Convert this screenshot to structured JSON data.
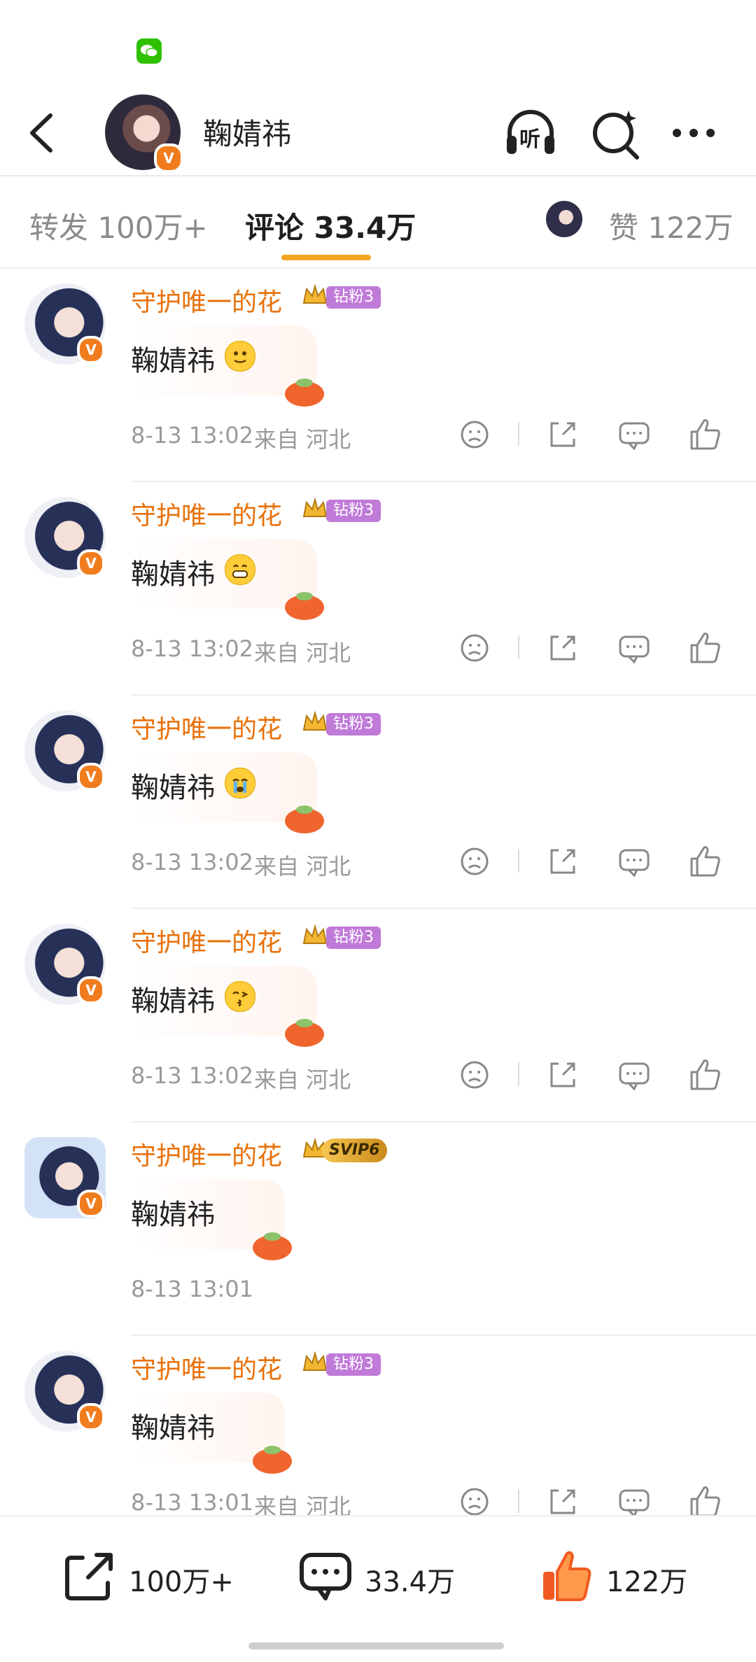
{
  "status_bar": {
    "app_icon": "wechat-icon"
  },
  "header": {
    "title": "鞠婧祎",
    "listen_label": "听",
    "icons": [
      "back-icon",
      "listen-icon",
      "search-ai-icon",
      "more-icon"
    ]
  },
  "tabs": {
    "repost": "转发 100万+",
    "comments": "评论 33.4万",
    "likes": "赞 122万"
  },
  "comments": [
    {
      "user": "守护唯一的花",
      "badge_type": "fan",
      "badge": "钻粉3",
      "text": "鞠婧祎",
      "emoji": "slight-smile",
      "time": "8-13 13:02",
      "location": "来自 河北"
    },
    {
      "user": "守护唯一的花",
      "badge_type": "fan",
      "badge": "钻粉3",
      "text": "鞠婧祎",
      "emoji": "grin",
      "time": "8-13 13:02",
      "location": "来自 河北"
    },
    {
      "user": "守护唯一的花",
      "badge_type": "fan",
      "badge": "钻粉3",
      "text": "鞠婧祎",
      "emoji": "cry",
      "time": "8-13 13:02",
      "location": "来自 河北"
    },
    {
      "user": "守护唯一的花",
      "badge_type": "fan",
      "badge": "钻粉3",
      "text": "鞠婧祎",
      "emoji": "kiss",
      "time": "8-13 13:02",
      "location": "来自 河北"
    },
    {
      "user": "守护唯一的花",
      "badge_type": "svip",
      "badge": "SVIP6",
      "text": "鞠婧祎",
      "emoji": "",
      "time": "8-13 13:01",
      "location": ""
    },
    {
      "user": "守护唯一的花",
      "badge_type": "fan",
      "badge": "钻粉3",
      "text": "鞠婧祎",
      "emoji": "",
      "time": "8-13 13:01",
      "location": "来自 河北"
    }
  ],
  "bottom_bar": {
    "repost_count": "100万+",
    "comment_count": "33.4万",
    "like_count": "122万"
  },
  "colors": {
    "accent": "#f4a623",
    "username": "#e8710a",
    "fan_badge": "#c07ad8",
    "like_active": "#f05a22"
  }
}
